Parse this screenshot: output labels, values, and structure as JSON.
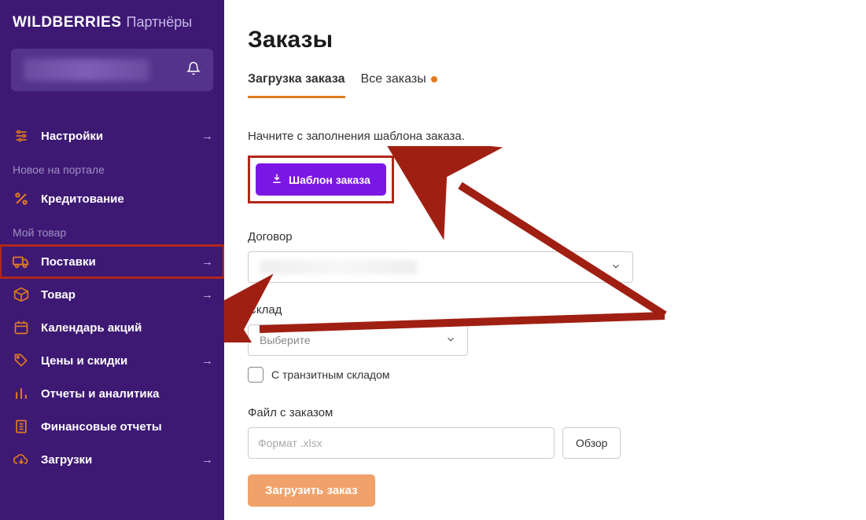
{
  "brand": {
    "main": "WILDBERRIES",
    "sub": "Партнёры"
  },
  "sidebar": {
    "settings_label": "Настройки",
    "section_new": "Новое на портале",
    "credit_label": "Кредитование",
    "section_goods": "Мой товар",
    "items": [
      {
        "label": "Поставки"
      },
      {
        "label": "Товар"
      },
      {
        "label": "Календарь акций"
      },
      {
        "label": "Цены и скидки"
      },
      {
        "label": "Отчеты и аналитика"
      },
      {
        "label": "Финансовые отчеты"
      },
      {
        "label": "Загрузки"
      }
    ]
  },
  "page": {
    "title": "Заказы",
    "tabs": {
      "upload": "Загрузка заказа",
      "all": "Все заказы"
    },
    "intro": "Начните с заполнения шаблона заказа.",
    "template_btn": "Шаблон заказа",
    "contract_label": "Договор",
    "warehouse_label": "Склад",
    "warehouse_placeholder": "Выберите",
    "transit_checkbox": "С транзитным складом",
    "file_label": "Файл с заказом",
    "file_placeholder": "Формат .xlsx",
    "browse_btn": "Обзор",
    "upload_btn": "Загрузить заказ"
  }
}
